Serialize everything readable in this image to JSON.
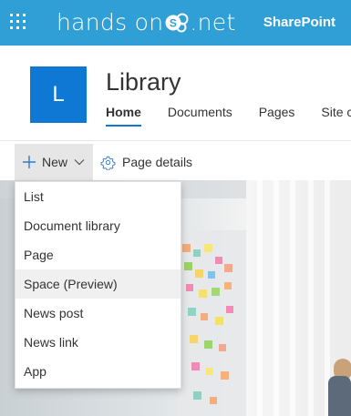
{
  "topbar": {
    "brand_left": "hands on",
    "brand_right": ".net",
    "brand_mark": "S",
    "product": "SharePoint",
    "colors": {
      "background": "#2f9fd6",
      "text": "#ffffff"
    }
  },
  "site": {
    "logo_letter": "L",
    "title": "Library",
    "nav": [
      "Home",
      "Documents",
      "Pages",
      "Site co"
    ],
    "active_nav": "Home",
    "accent": "#0f78d4"
  },
  "commandbar": {
    "new_label": "New",
    "details_label": "Page details",
    "icons": {
      "new": "plus-icon",
      "new_menu": "chevron-down-icon",
      "details": "gear-icon"
    }
  },
  "new_menu": {
    "items": [
      "List",
      "Document library",
      "Page",
      "Space (Preview)",
      "News post",
      "News link",
      "App"
    ],
    "hovered": "Space (Preview)"
  }
}
